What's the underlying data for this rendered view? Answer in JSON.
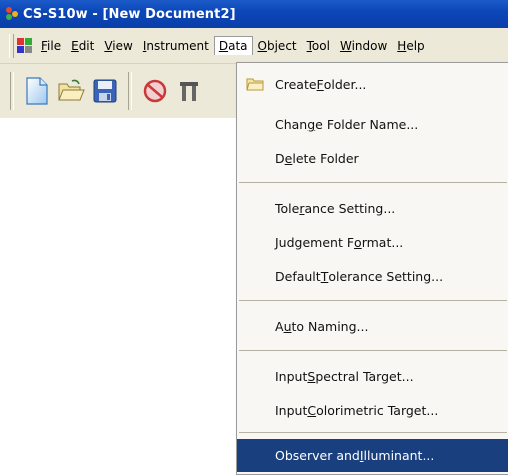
{
  "window": {
    "title": "CS-S10w - [New Document2]"
  },
  "menubar": {
    "items": [
      {
        "pre": "",
        "u": "F",
        "post": "ile"
      },
      {
        "pre": "",
        "u": "E",
        "post": "dit"
      },
      {
        "pre": "",
        "u": "V",
        "post": "iew"
      },
      {
        "pre": "",
        "u": "I",
        "post": "nstrument"
      },
      {
        "pre": "",
        "u": "D",
        "post": "ata"
      },
      {
        "pre": "",
        "u": "O",
        "post": "bject"
      },
      {
        "pre": "",
        "u": "T",
        "post": "ool"
      },
      {
        "pre": "",
        "u": "W",
        "post": "indow"
      },
      {
        "pre": "",
        "u": "H",
        "post": "elp"
      }
    ]
  },
  "toolbar": {
    "icons": [
      "new-document-icon",
      "open-folder-icon",
      "save-disk-icon",
      "no-entry-icon",
      "tools-icon"
    ]
  },
  "data_menu": {
    "items": [
      {
        "pre": "Create ",
        "u": "F",
        "post": "older..."
      },
      {
        "pre": "Chan",
        "u": "g",
        "post": "e Folder Name..."
      },
      {
        "pre": "D",
        "u": "e",
        "post": "lete Folder"
      },
      {
        "pre": "Tole",
        "u": "r",
        "post": "ance Setting..."
      },
      {
        "pre": "Judgement F",
        "u": "o",
        "post": "rmat..."
      },
      {
        "pre": "Default ",
        "u": "T",
        "post": "olerance Setting..."
      },
      {
        "pre": "A",
        "u": "u",
        "post": "to Naming..."
      },
      {
        "pre": "Input ",
        "u": "S",
        "post": "pectral Target..."
      },
      {
        "pre": "Input ",
        "u": "C",
        "post": "olorimetric Target..."
      },
      {
        "pre": "Observer and ",
        "u": "I",
        "post": "lluminant..."
      }
    ],
    "highlight_color": "#1a3f7e"
  }
}
